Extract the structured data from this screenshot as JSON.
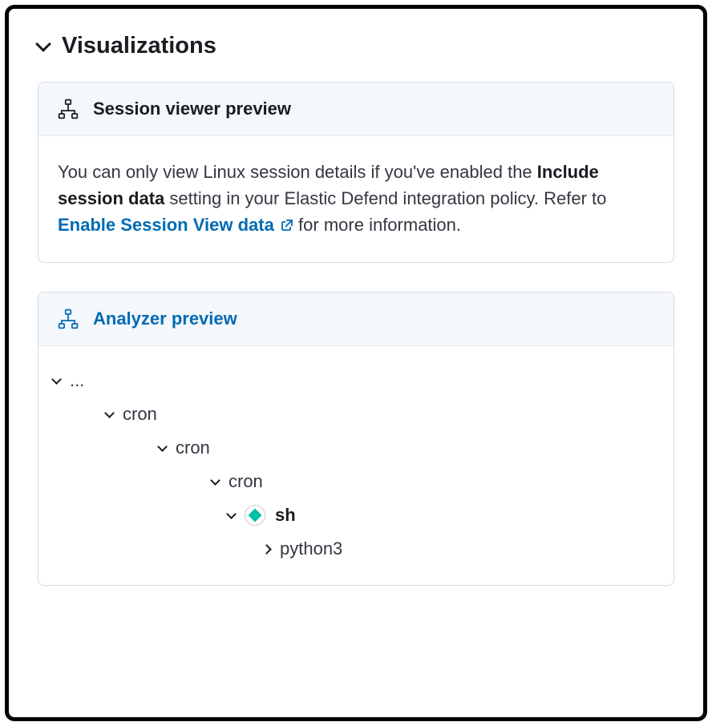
{
  "section": {
    "title": "Visualizations"
  },
  "session_panel": {
    "title": "Session viewer preview",
    "body_prefix": "You can only view Linux session details if you've enabled the ",
    "body_strong": "Include session data",
    "body_mid": " setting in your Elastic Defend integration policy. Refer to ",
    "link_text": "Enable Session View data",
    "body_suffix": " for more information."
  },
  "analyzer_panel": {
    "title": "Analyzer preview",
    "tree": [
      {
        "label": "...",
        "indent": 0,
        "expanded": true,
        "bold": false,
        "badge": false
      },
      {
        "label": "cron",
        "indent": 1,
        "expanded": true,
        "bold": false,
        "badge": false
      },
      {
        "label": "cron",
        "indent": 2,
        "expanded": true,
        "bold": false,
        "badge": false
      },
      {
        "label": "cron",
        "indent": 3,
        "expanded": true,
        "bold": false,
        "badge": false
      },
      {
        "label": "sh",
        "indent": 4,
        "expanded": true,
        "bold": true,
        "badge": true
      },
      {
        "label": "python3",
        "indent": 5,
        "expanded": false,
        "bold": false,
        "badge": false
      }
    ]
  }
}
